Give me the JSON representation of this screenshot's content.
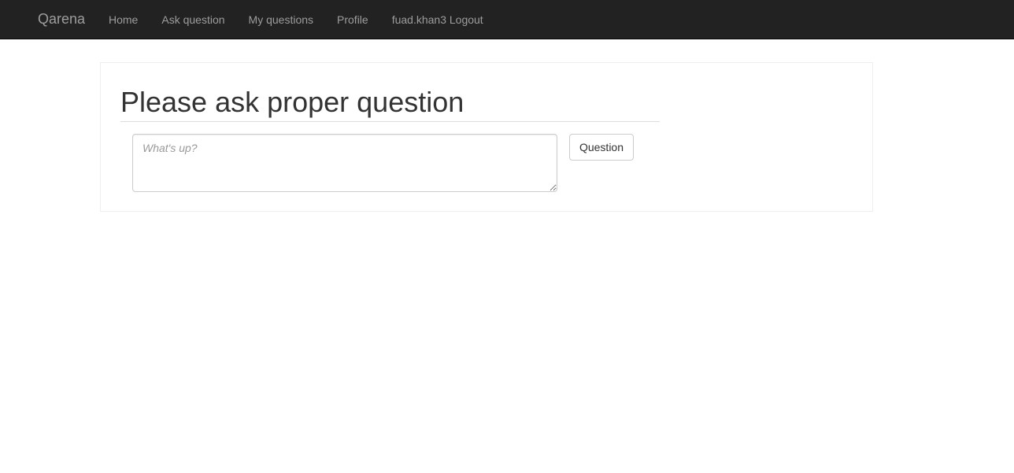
{
  "navbar": {
    "brand": "Qarena",
    "items": [
      {
        "label": "Home"
      },
      {
        "label": "Ask question"
      },
      {
        "label": "My questions"
      },
      {
        "label": "Profile"
      },
      {
        "label": "fuad.khan3 Logout"
      }
    ]
  },
  "main": {
    "title": "Please ask proper question",
    "question_input": {
      "placeholder": "What's up?",
      "value": ""
    },
    "submit_label": "Question"
  }
}
